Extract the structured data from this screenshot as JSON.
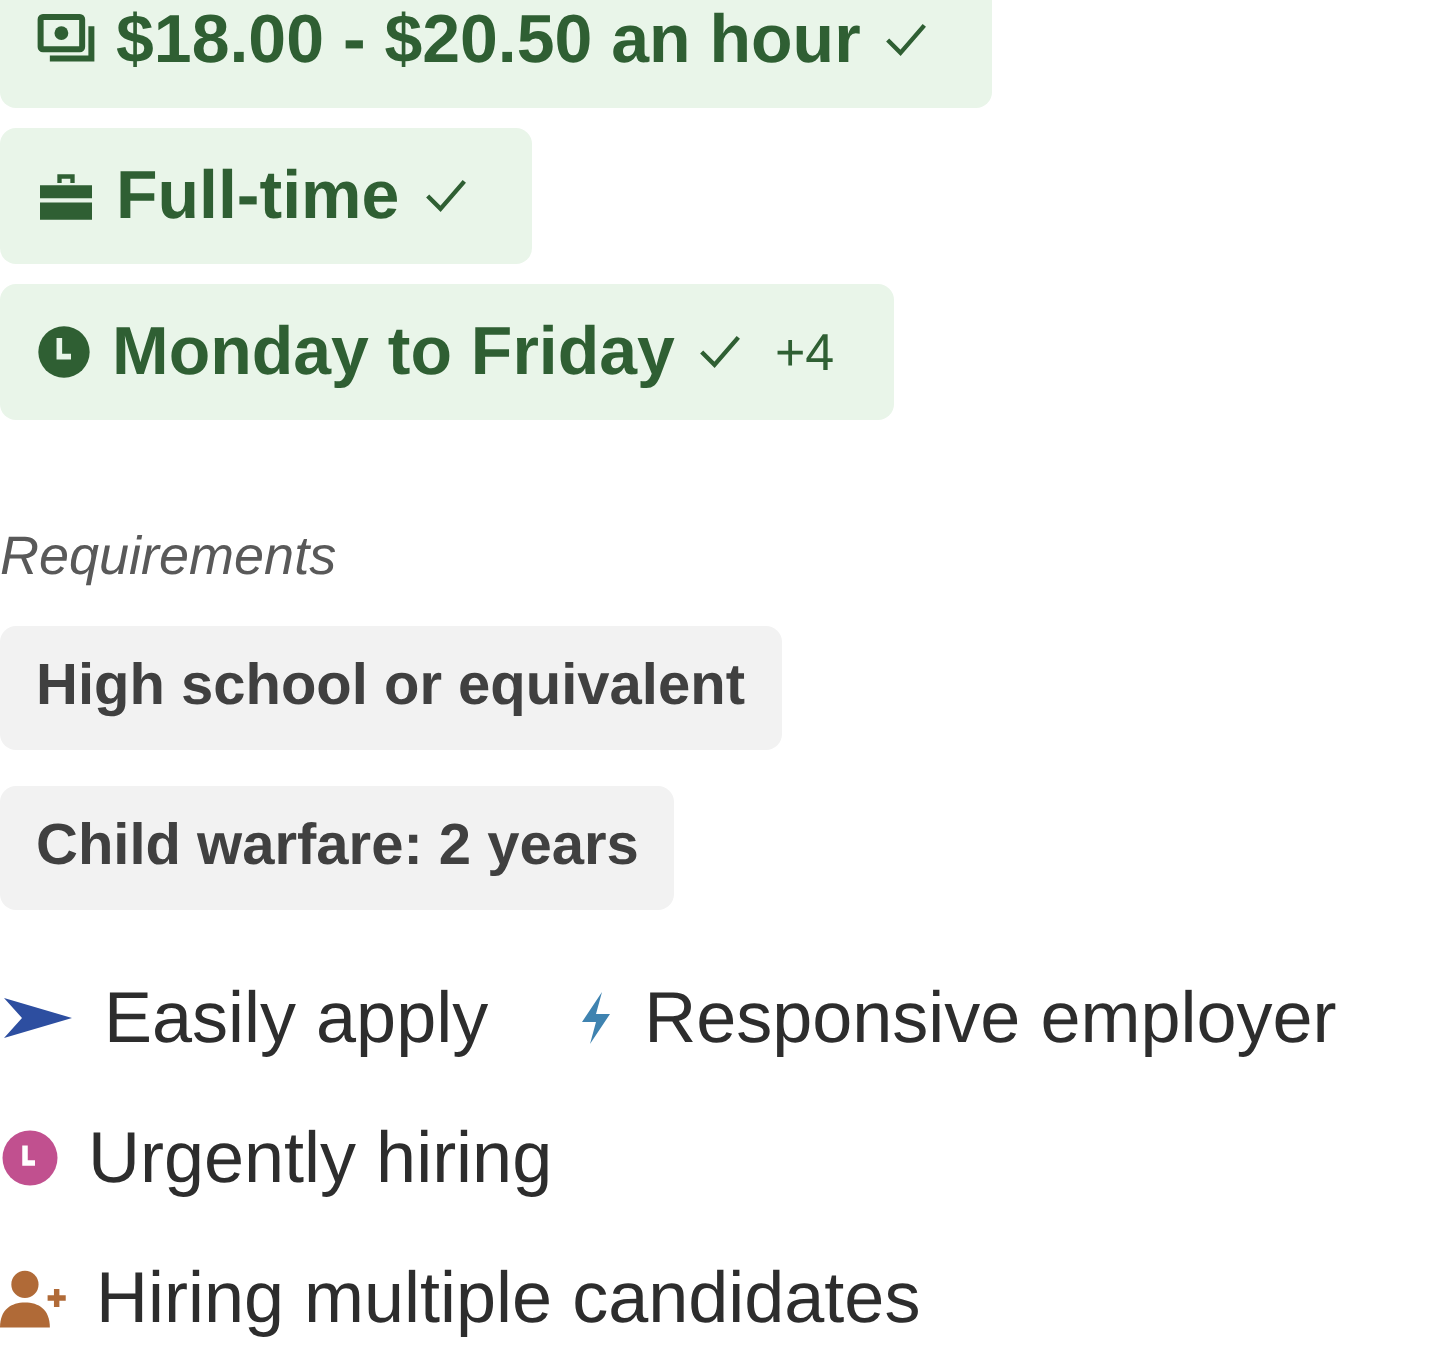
{
  "job_tags": [
    {
      "kind": "pay",
      "label": "$18.00 - $20.50 an hour",
      "checked": true
    },
    {
      "kind": "job-type",
      "label": "Full-time",
      "checked": true
    },
    {
      "kind": "schedule",
      "label": "Monday to Friday",
      "checked": true,
      "more": "+4"
    }
  ],
  "requirements": {
    "heading": "Requirements",
    "items": [
      "High school or equivalent",
      "Child warfare: 2 years"
    ]
  },
  "features": [
    [
      {
        "kind": "easy-apply",
        "label": "Easily apply"
      },
      {
        "kind": "responsive",
        "label": "Responsive employer"
      }
    ],
    [
      {
        "kind": "urgent",
        "label": "Urgently hiring"
      }
    ],
    [
      {
        "kind": "multiple",
        "label": "Hiring multiple candidates"
      }
    ]
  ]
}
